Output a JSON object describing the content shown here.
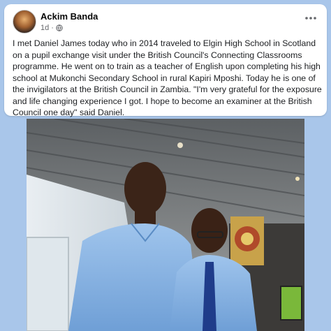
{
  "post": {
    "author": "Ackim Banda",
    "time": "1d",
    "separator": "·",
    "more_icon": "more-dots-icon",
    "privacy_icon": "globe-icon",
    "body": "I met Daniel James today who in 2014 traveled to Elgin High School in Scotland on a pupil exchange visit under the British Council's Connecting Classrooms programme. He went on to train as a teacher of English upon completing his high school at Mukonchi Secondary School in rural Kapiri Mposhi. Today he is one of the invigilators at the British Council in Zambia. \"I'm very grateful for the exposure and life changing experience I got. I hope to become an examiner at the British Council one day\" said Daniel."
  },
  "colors": {
    "background": "#a9c6ea",
    "card": "#ffffff",
    "author_text": "#050505",
    "meta_text": "#65676b"
  }
}
